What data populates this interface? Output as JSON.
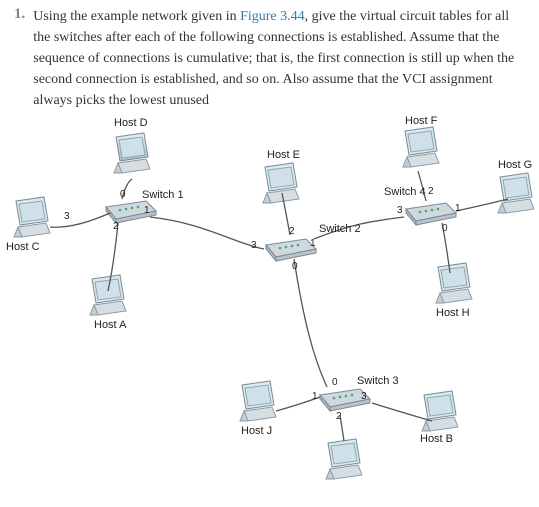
{
  "question": {
    "number": "1.",
    "text_before": "Using the example network given in ",
    "figref": "Figure 3.44",
    "text_after": ", give the virtual circuit tables for all the switches after each of the following connections is established. Assume that the sequence of connections is cumulative; that is, the first connection is still up when the second connection is established, and so on. Also assume that the VCI assignment always picks the lowest unused"
  },
  "labels": {
    "hostA": "Host A",
    "hostB": "Host B",
    "hostC": "Host C",
    "hostD": "Host D",
    "hostE": "Host E",
    "hostF": "Host F",
    "hostG": "Host G",
    "hostH": "Host H",
    "hostJ": "Host J",
    "hostI": "",
    "switch1": "Switch 1",
    "switch2": "Switch 2",
    "switch3": "Switch 3",
    "switch4": "Switch 4"
  },
  "ports": {
    "s1_0": "0",
    "s1_1": "1",
    "s1_2": "2",
    "s1_3": "3",
    "s2_0": "0",
    "s2_1": "1",
    "s2_2": "2",
    "s2_3": "3",
    "s3_0": "0",
    "s3_1": "1",
    "s3_2": "2",
    "s3_3": "3",
    "s4_0": "0",
    "s4_1": "1",
    "s4_2": "2",
    "s4_3": "3"
  }
}
